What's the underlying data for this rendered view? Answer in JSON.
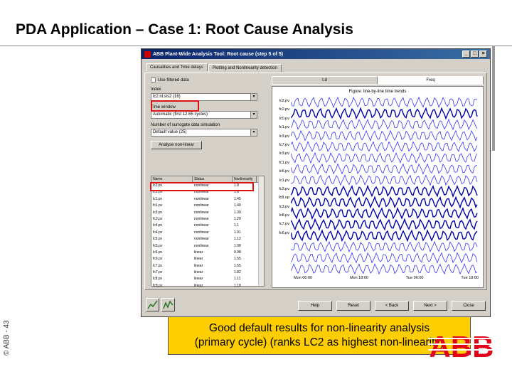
{
  "slide": {
    "title": "PDA Application – Case 1: Root Cause Analysis",
    "copyright": "© ABB - 43",
    "callout_line1": "Good default results for non-linearity analysis",
    "callout_line2": "(primary cycle) (ranks LC2 as highest non-linearity)",
    "logo": "ABB"
  },
  "window": {
    "title": "ABB Plant-Wide Analysis Tool: Root cause (step 5 of 5)",
    "tabs": [
      "Causalities and Time delays",
      "Plotting and Nonlinearity detection"
    ],
    "filter_checkbox_label": "Use filtered data",
    "index_label": "Index",
    "index_value": "lc2.nl.sis2 (16)",
    "time_window_label": "Time window",
    "time_window_value": "Automatic (first 12.65 cycles)",
    "estimation_label": "Number of surrogate data simulation",
    "estimation_value": "Default value (25)",
    "analyze_button": "Analyse non-linear",
    "list_headers": [
      "Name",
      "Status",
      "Nonlinearity"
    ],
    "list_rows": [
      [
        "lc2.pv",
        "nonlinear",
        "1.8"
      ],
      [
        "fc2.pv",
        "nonlinear",
        "1.6"
      ],
      [
        "lc1.pv",
        "nonlinear",
        "1.45"
      ],
      [
        "fc1.pv",
        "nonlinear",
        "1.40"
      ],
      [
        "lc3.pv",
        "nonlinear",
        "1.30"
      ],
      [
        "fc3.pv",
        "nonlinear",
        "1.20"
      ],
      [
        "lc4.pv",
        "nonlinear",
        "1.1"
      ],
      [
        "fc4.pv",
        "nonlinear",
        "1.01"
      ],
      [
        "lc5.pv",
        "nonlinear",
        "1.12"
      ],
      [
        "fc5.pv",
        "nonlinear",
        "1.00"
      ],
      [
        "lc6.pv",
        "linear",
        "0.98"
      ],
      [
        "fc6.pv",
        "linear",
        "1.55"
      ],
      [
        "lc7.pv",
        "linear",
        "1.55"
      ],
      [
        "fc7.pv",
        "linear",
        "1.82"
      ],
      [
        "lc8.pv",
        "linear",
        "1.11"
      ],
      [
        "fc8.pv",
        "linear",
        "1.10"
      ]
    ],
    "right_tabs": [
      "t.d",
      "Freq"
    ],
    "plot_title": "Figure: line-by-line time trends",
    "plot_series": [
      "lc2.pv",
      "fc2.pv",
      "lc0.pv",
      "fc1.pv",
      "lc3.pv",
      "fc7.pv",
      "lc3.pv",
      "fc1.pv",
      "lc6.pv",
      "lc1.pv",
      "fc3.pv",
      "fc8.op",
      "lc3.pv",
      "lc8.pv",
      "lc7.pv",
      "fc6.pv"
    ],
    "plot_x_labels": [
      "Mon 06:00",
      "Mon 18:00",
      "Tue 06:00",
      "Tue 18:00"
    ],
    "buttons": [
      "Help",
      "Reset",
      "< Back",
      "Next >",
      "Close"
    ]
  }
}
